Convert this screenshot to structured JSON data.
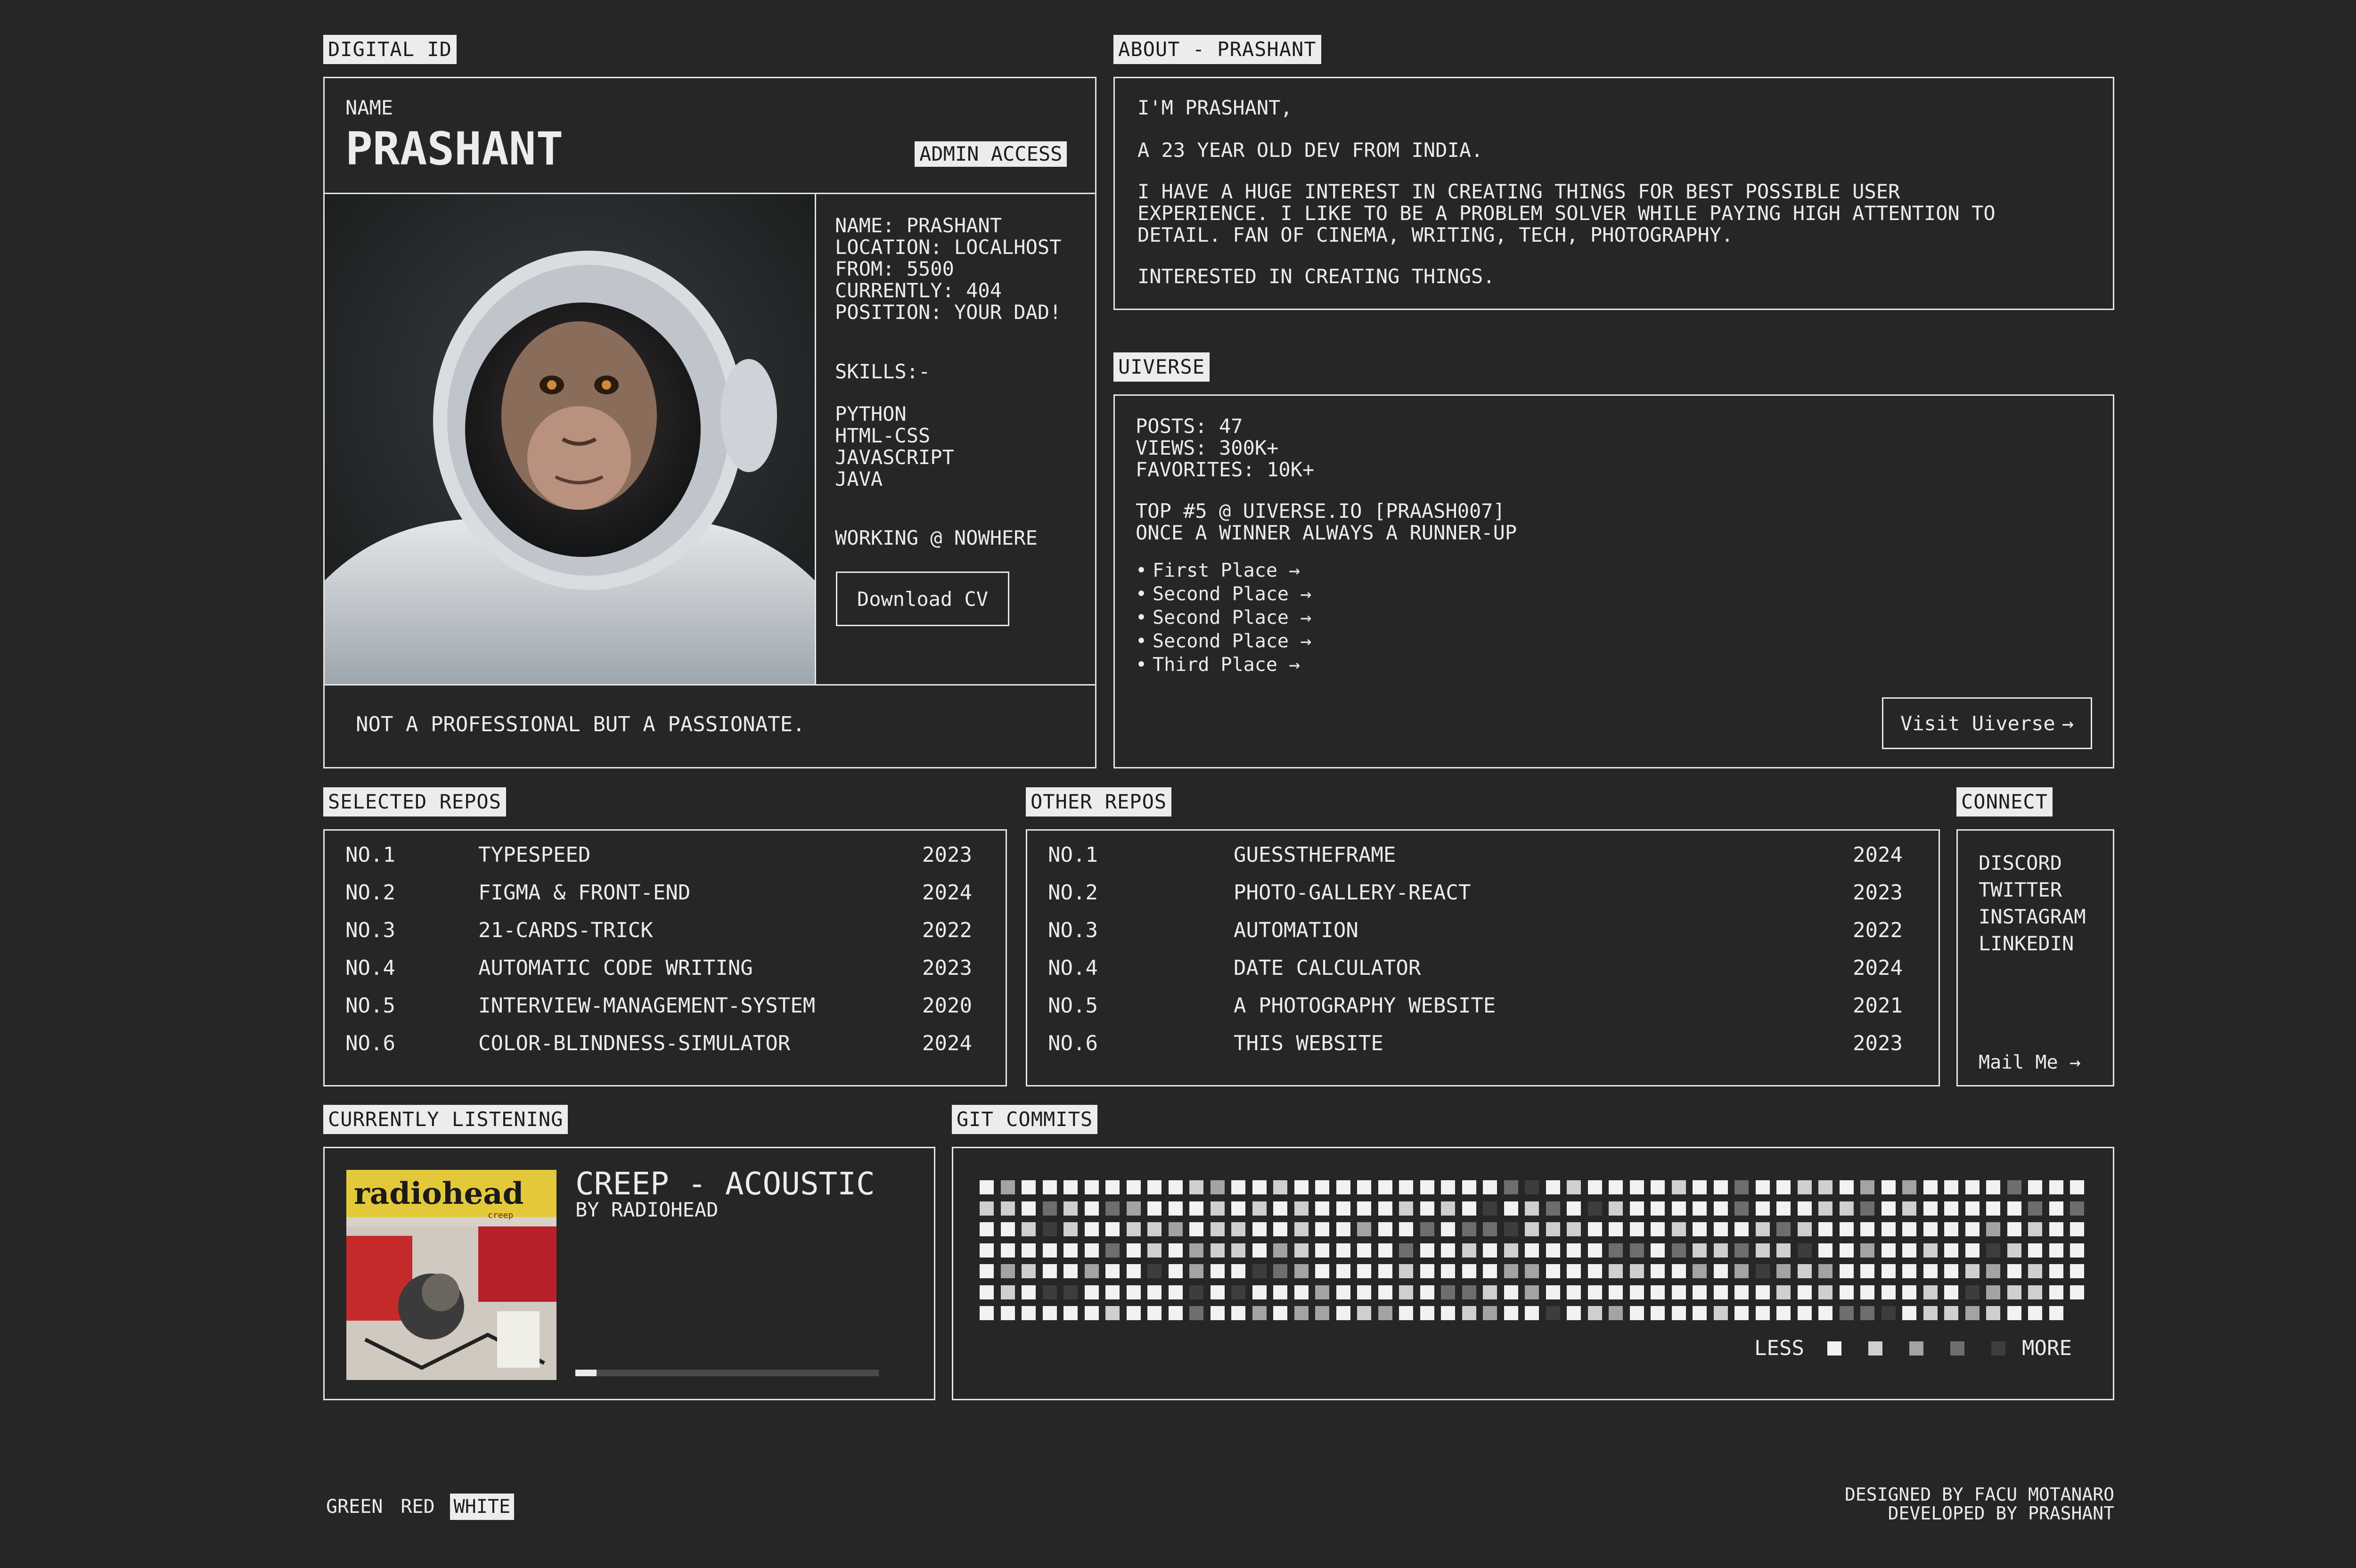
{
  "digital_id": {
    "label": "DIGITAL ID",
    "name_caption": "NAME",
    "name": "PRASHANT",
    "admin_badge": "ADMIN ACCESS",
    "details": [
      "NAME: PRASHANT",
      "LOCATION: LOCALHOST",
      "FROM: 5500",
      "CURRENTLY: 404",
      "POSITION: YOUR DAD!"
    ],
    "skills_title": "SKILLS:-",
    "skills": [
      "PYTHON",
      "HTML-CSS",
      "JAVASCRIPT",
      "JAVA"
    ],
    "working": "WORKING @ NOWHERE",
    "download_button": "Download CV",
    "footer_text": "NOT A PROFESSIONAL BUT A PASSIONATE.",
    "photo_icon": "astronaut-monkey-photo"
  },
  "about": {
    "label": "ABOUT - PRASHANT",
    "p1": "I'M PRASHANT,",
    "p2": "A 23 YEAR OLD DEV FROM INDIA.",
    "p3": [
      "I HAVE A HUGE INTEREST IN CREATING THINGS FOR BEST POSSIBLE USER",
      "EXPERIENCE. I LIKE TO BE A PROBLEM SOLVER WHILE PAYING HIGH ATTENTION TO",
      "DETAIL. FAN OF CINEMA, WRITING, TECH, PHOTOGRAPHY."
    ],
    "p4": "INTERESTED IN CREATING THINGS."
  },
  "uiverse": {
    "label": "UIVERSE",
    "stats": [
      "POSTS: 47",
      "VIEWS: 300K+",
      "FAVORITES: 10K+"
    ],
    "rank": [
      "TOP #5 @ UIVERSE.IO [PRAASH007]",
      "ONCE A WINNER ALWAYS A RUNNER-UP"
    ],
    "places": [
      "First Place",
      "Second Place",
      "Second Place",
      "Second Place",
      "Third Place"
    ],
    "visit_button": "Visit Uiverse"
  },
  "selected_repos": {
    "label": "SELECTED REPOS",
    "rows": [
      {
        "no": "NO.1",
        "name": "TYPESPEED",
        "year": "2023"
      },
      {
        "no": "NO.2",
        "name": "FIGMA & FRONT-END",
        "year": "2024"
      },
      {
        "no": "NO.3",
        "name": "21-CARDS-TRICK",
        "year": "2022"
      },
      {
        "no": "NO.4",
        "name": "AUTOMATIC CODE WRITING",
        "year": "2023"
      },
      {
        "no": "NO.5",
        "name": "INTERVIEW-MANAGEMENT-SYSTEM",
        "year": "2020"
      },
      {
        "no": "NO.6",
        "name": "COLOR-BLINDNESS-SIMULATOR",
        "year": "2024"
      }
    ]
  },
  "other_repos": {
    "label": "OTHER REPOS",
    "rows": [
      {
        "no": "NO.1",
        "name": "GUESSTHEFRAME",
        "year": "2024"
      },
      {
        "no": "NO.2",
        "name": "PHOTO-GALLERY-REACT",
        "year": "2023"
      },
      {
        "no": "NO.3",
        "name": "AUTOMATION",
        "year": "2022"
      },
      {
        "no": "NO.4",
        "name": "DATE CALCULATOR",
        "year": "2024"
      },
      {
        "no": "NO.5",
        "name": "A PHOTOGRAPHY WEBSITE",
        "year": "2021"
      },
      {
        "no": "NO.6",
        "name": "THIS WEBSITE",
        "year": "2023"
      }
    ]
  },
  "connect": {
    "label": "CONNECT",
    "links": [
      "DISCORD",
      "TWITTER",
      "INSTAGRAM",
      "LINKEDIN"
    ],
    "mail_button": "Mail Me"
  },
  "listening": {
    "label": "CURRENTLY LISTENING",
    "song": "CREEP - ACOUSTIC",
    "artist": "BY RADIOHEAD",
    "album_brand": "radiohead",
    "album_sub": "creep",
    "progress": 0.07
  },
  "git": {
    "label": "GIT COMMITS",
    "less": "LESS",
    "more": "MORE",
    "levels": [
      "#f2f2f2",
      "#cfcfcf",
      "#a3a3a3",
      "#6e6e6e",
      "#3d3d3d"
    ]
  },
  "theme": {
    "options": [
      "GREEN",
      "RED",
      "WHITE"
    ],
    "active": "WHITE"
  },
  "credits": {
    "designed": "DESIGNED BY FACU MOTANARO",
    "developed": "DEVELOPED BY PRASHANT"
  },
  "colors": {
    "background": "#262626",
    "foreground": "#ececec",
    "border": "#e6e6e6"
  }
}
